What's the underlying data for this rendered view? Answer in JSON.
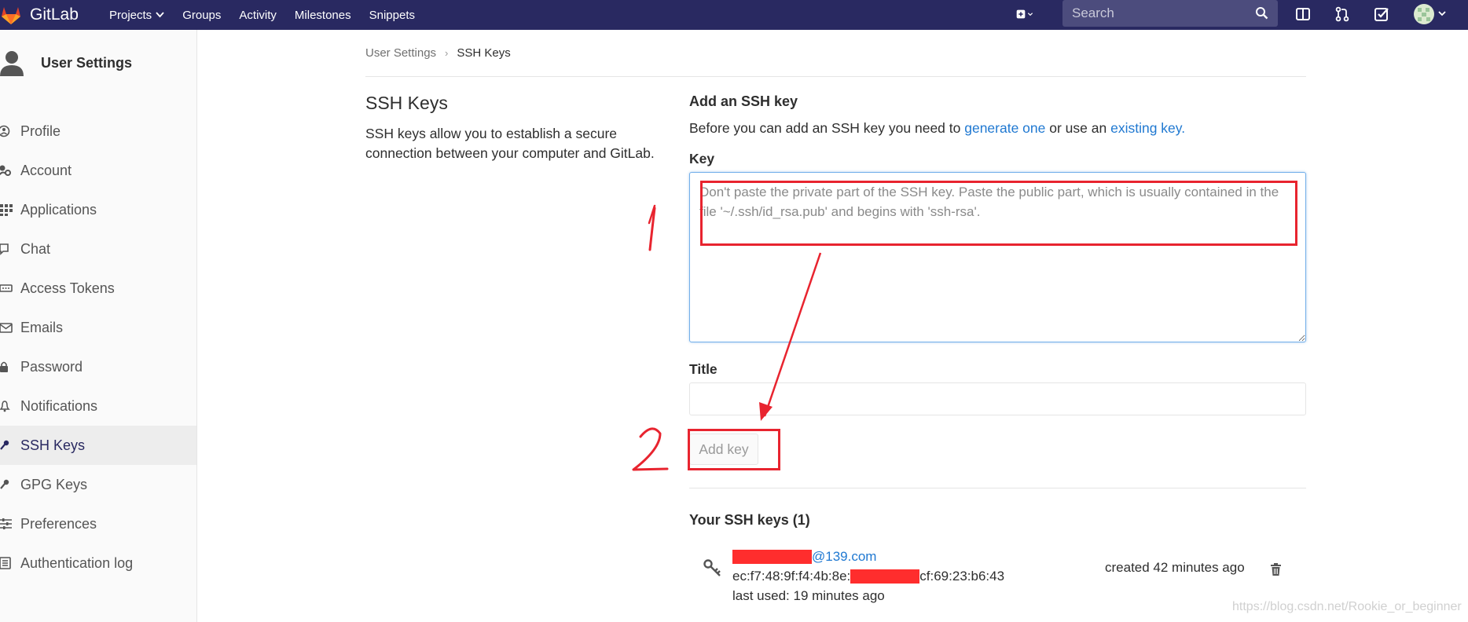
{
  "navbar": {
    "brand": "GitLab",
    "links": [
      {
        "label": "Projects",
        "has_dropdown": true
      },
      {
        "label": "Groups"
      },
      {
        "label": "Activity"
      },
      {
        "label": "Milestones"
      },
      {
        "label": "Snippets"
      }
    ],
    "search_placeholder": "Search",
    "right_icons": [
      "plus-square-icon",
      "sidebar-toggle-icon",
      "merge-request-icon",
      "todo-check-icon",
      "user-avatar"
    ],
    "colors": {
      "bg": "#292961",
      "search_bg": "#4c4c7d"
    }
  },
  "sidebar": {
    "title": "User Settings",
    "items": [
      {
        "label": "Profile",
        "icon": "profile-icon"
      },
      {
        "label": "Account",
        "icon": "account-gear-icon"
      },
      {
        "label": "Applications",
        "icon": "applications-grid-icon"
      },
      {
        "label": "Chat",
        "icon": "chat-icon"
      },
      {
        "label": "Access Tokens",
        "icon": "token-icon"
      },
      {
        "label": "Emails",
        "icon": "email-icon"
      },
      {
        "label": "Password",
        "icon": "lock-icon"
      },
      {
        "label": "Notifications",
        "icon": "bell-icon"
      },
      {
        "label": "SSH Keys",
        "icon": "key-icon",
        "active": true
      },
      {
        "label": "GPG Keys",
        "icon": "key-icon"
      },
      {
        "label": "Preferences",
        "icon": "sliders-icon"
      },
      {
        "label": "Authentication log",
        "icon": "list-icon"
      }
    ]
  },
  "breadcrumb": {
    "parent": "User Settings",
    "current": "SSH Keys"
  },
  "section": {
    "title": "SSH Keys",
    "description": "SSH keys allow you to establish a secure connection between your computer and GitLab."
  },
  "form": {
    "heading": "Add an SSH key",
    "intro_before": "Before you can add an SSH key you need to ",
    "generate_link": "generate one",
    "intro_middle": " or use an ",
    "existing_link": "existing key.",
    "key_label": "Key",
    "key_placeholder": "Don't paste the private part of the SSH key. Paste the public part, which is usually contained in the file '~/.ssh/id_rsa.pub' and begins with 'ssh-rsa'.",
    "title_label": "Title",
    "title_value": "",
    "add_button": "Add key"
  },
  "keys": {
    "heading": "Your SSH keys (1)",
    "items": [
      {
        "email_suffix": "@139.com",
        "fingerprint_start": "ec:f7:48:9f:f4:4b:8e:",
        "fingerprint_end": "cf:69:23:b6:43",
        "last_used": "last used: 19 minutes ago",
        "created": "created 42 minutes ago"
      }
    ]
  },
  "annotations": {
    "mark_1": "1",
    "mark_2": "2",
    "color": "#e8242f"
  },
  "watermark": "https://blog.csdn.net/Rookie_or_beginner"
}
